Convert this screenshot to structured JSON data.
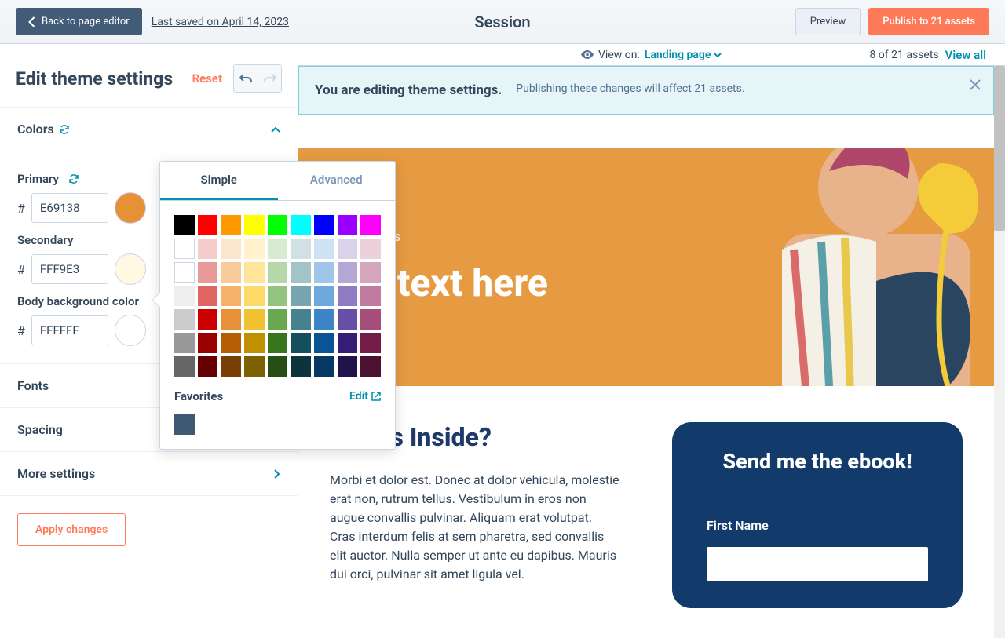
{
  "topbar": {
    "back": "Back to page editor",
    "saved": "Last saved on April 14, 2023",
    "title": "Session",
    "preview": "Preview",
    "publish": "Publish to 21 assets"
  },
  "viewbar": {
    "viewon_label": "View on:",
    "viewon_value": "Landing page",
    "assets_count": "8 of 21 assets",
    "viewall": "View all"
  },
  "sidebar": {
    "heading": "Edit theme settings",
    "reset": "Reset",
    "sections": {
      "colors": "Colors",
      "fonts": "Fonts",
      "spacing": "Spacing",
      "more": "More settings"
    },
    "fields": {
      "primary": {
        "label": "Primary",
        "hex": "E69138",
        "swatch": "#E69138"
      },
      "secondary": {
        "label": "Secondary",
        "hex": "FFF9E3",
        "swatch": "#FFF9E3"
      },
      "body_bg": {
        "label": "Body background color",
        "hex": "FFFFFF",
        "swatch": "#FFFFFF"
      }
    },
    "apply": "Apply changes"
  },
  "popover": {
    "tab_simple": "Simple",
    "tab_advanced": "Advanced",
    "rows": [
      [
        "#000000",
        "#ff0000",
        "#ff9900",
        "#ffff00",
        "#00ff00",
        "#00ffff",
        "#0000ff",
        "#9900ff",
        "#ff00ff"
      ],
      [
        "#ffffff",
        "#f4cccc",
        "#fce5cd",
        "#fff2cc",
        "#d9ead3",
        "#d0e0e3",
        "#cfe2f3",
        "#d9d2e9",
        "#ead1dc"
      ],
      [
        "#ffffff",
        "#ea9999",
        "#f9cb9c",
        "#ffe599",
        "#b6d7a8",
        "#a2c4c9",
        "#9fc5e8",
        "#b4a7d6",
        "#d5a6bd"
      ],
      [
        "#eeeeee",
        "#e06666",
        "#f6b26b",
        "#ffd966",
        "#93c47d",
        "#76a5af",
        "#6fa8dc",
        "#8e7cc3",
        "#c27ba0"
      ],
      [
        "#cccccc",
        "#cc0000",
        "#e69138",
        "#f1c232",
        "#6aa84f",
        "#45818e",
        "#3d85c6",
        "#674ea7",
        "#a64d79"
      ],
      [
        "#999999",
        "#990000",
        "#b45f06",
        "#bf9000",
        "#38761d",
        "#134f5c",
        "#0b5394",
        "#351c75",
        "#741b47"
      ],
      [
        "#666666",
        "#660000",
        "#783f04",
        "#7f6000",
        "#274e13",
        "#0c343d",
        "#073763",
        "#20124d",
        "#4c1130"
      ]
    ],
    "favorites_label": "Favorites",
    "edit": "Edit",
    "favorite_color": "#3e5974"
  },
  "banner": {
    "title": "You are editing theme settings.",
    "subtitle": "Publishing these changes will affect 21 assets."
  },
  "preview": {
    "hero_breadcrumb": "ng Pages",
    "hero_title": "dd text here",
    "body_heading": "What's Inside?",
    "body_p": "Morbi et dolor est. Donec at dolor vehicula, molestie erat non, rutrum tellus. Vestibulum in eros non augue convallis pulvinar. Aliquam erat volutpat. Cras interdum felis at sem pharetra, sed convallis elit auctor. Nulla semper ut ante eu dapibus. Mauris dui orci, pulvinar sit amet ligula vel.",
    "form_heading": "Send me the ebook!",
    "form_label": "First Name"
  }
}
